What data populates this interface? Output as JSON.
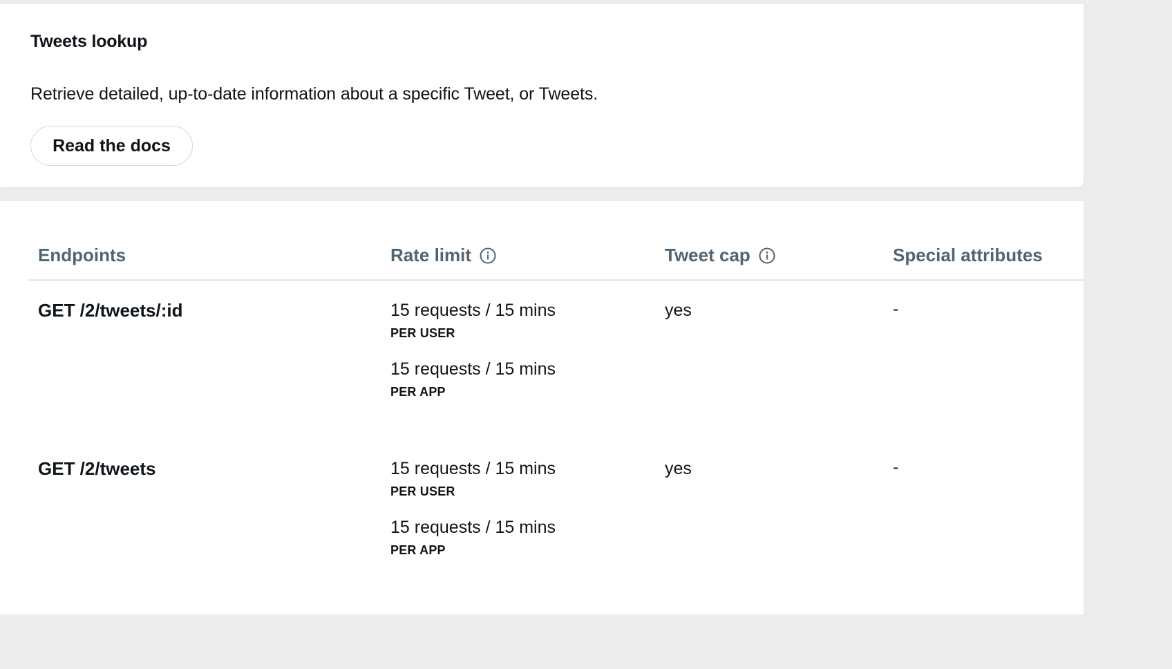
{
  "section": {
    "title": "Tweets lookup",
    "description": "Retrieve detailed, up-to-date information about a specific Tweet, or Tweets.",
    "docs_button_label": "Read the docs"
  },
  "table": {
    "headers": {
      "endpoints": "Endpoints",
      "rate_limit": "Rate limit",
      "tweet_cap": "Tweet cap",
      "special_attributes": "Special attributes"
    },
    "info_icon": "info-circle-icon",
    "rows": [
      {
        "endpoint": "GET /2/tweets/:id",
        "rate_limits": [
          {
            "value": "15 requests / 15 mins",
            "scope": "PER USER"
          },
          {
            "value": "15 requests / 15 mins",
            "scope": "PER APP"
          }
        ],
        "tweet_cap": "yes",
        "special_attributes": "-"
      },
      {
        "endpoint": "GET /2/tweets",
        "rate_limits": [
          {
            "value": "15 requests / 15 mins",
            "scope": "PER USER"
          },
          {
            "value": "15 requests / 15 mins",
            "scope": "PER APP"
          }
        ],
        "tweet_cap": "yes",
        "special_attributes": "-"
      }
    ]
  },
  "colors": {
    "page_background": "#ebeceb",
    "card_background": "#ffffff",
    "header_text": "#536471",
    "body_text": "#0f1419",
    "button_border": "#cfd9de"
  }
}
